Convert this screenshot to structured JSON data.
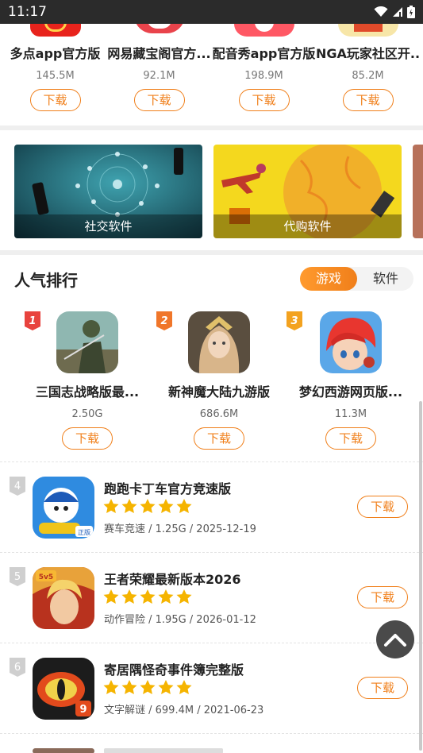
{
  "status_bar": {
    "time": "11:17"
  },
  "top_apps": [
    {
      "name": "多点app官方版",
      "size": "145.5M",
      "button": "下载",
      "icon": "duodian-app-icon"
    },
    {
      "name": "网易藏宝阁官方...",
      "size": "92.1M",
      "button": "下载",
      "icon": "cangbaoge-app-icon"
    },
    {
      "name": "配音秀app官方版",
      "size": "198.9M",
      "button": "下载",
      "icon": "peiyinxiu-app-icon"
    },
    {
      "name": "NGA玩家社区开...",
      "size": "85.2M",
      "button": "下载",
      "icon": "nga-app-icon"
    }
  ],
  "categories": [
    {
      "label": "社交软件"
    },
    {
      "label": "代购软件"
    }
  ],
  "ranking": {
    "title": "人气排行",
    "tabs": [
      {
        "label": "游戏",
        "active": true
      },
      {
        "label": "软件",
        "active": false
      }
    ],
    "top3": [
      {
        "rank": "1",
        "name": "三国志战略版最...",
        "size": "2.50G",
        "button": "下载",
        "badge_color": "#e8433e"
      },
      {
        "rank": "2",
        "name": "新神魔大陆九游版",
        "size": "686.6M",
        "button": "下载",
        "badge_color": "#f0762a"
      },
      {
        "rank": "3",
        "name": "梦幻西游网页版...",
        "size": "11.3M",
        "button": "下载",
        "badge_color": "#f3a21f"
      }
    ],
    "list": [
      {
        "rank": "4",
        "name": "跑跑卡丁车官方竞速版",
        "meta": "赛车竞速 / 1.25G / 2025-12-19",
        "stars": 5,
        "button": "下载"
      },
      {
        "rank": "5",
        "name": "王者荣耀最新版本2026",
        "meta": "动作冒险 / 1.95G / 2026-01-12",
        "stars": 5,
        "button": "下载"
      },
      {
        "rank": "6",
        "name": "寄居隅怪奇事件簿完整版",
        "meta": "文字解谜 / 699.4M / 2021-06-23",
        "stars": 5,
        "button": "下载"
      }
    ]
  },
  "colors": {
    "accent": "#f07f1a",
    "star": "#f5b400"
  }
}
